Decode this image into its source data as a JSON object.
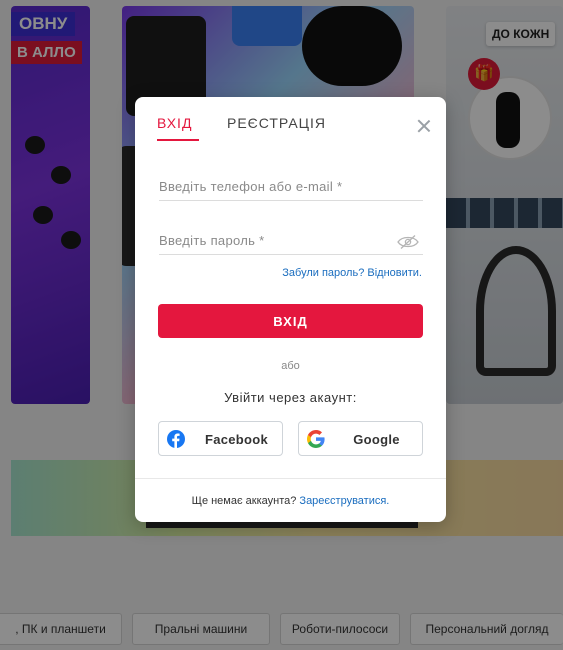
{
  "background": {
    "promo_left_line1": "ОВНУ",
    "promo_left_line2": "В АЛЛО",
    "promo_right": "ДО КОЖН",
    "categories": [
      {
        "label": ", ПК и планшети"
      },
      {
        "label": "Пральні машини"
      },
      {
        "label": "Роботи-пилососи"
      },
      {
        "label": "Персональний догляд"
      }
    ]
  },
  "modal": {
    "tabs": [
      {
        "label": "ВХІД",
        "active": true
      },
      {
        "label": "РЕЄСТРАЦІЯ",
        "active": false
      }
    ],
    "login_input": {
      "placeholder": "Введіть телефон або e-mail *",
      "value": ""
    },
    "password_input": {
      "placeholder": "Введіть пароль *",
      "value": ""
    },
    "forgot_link": "Забули пароль? Відновити.",
    "submit_label": "ВХІД",
    "or_text": "або",
    "via_account_text": "Увійти через акаунт:",
    "social": {
      "facebook_label": "Facebook",
      "google_label": "Google"
    },
    "footer": {
      "question": "Ще немає аккаунта?",
      "register_link": "Зареєструватися."
    }
  },
  "colors": {
    "accent": "#e4173e",
    "link": "#1a6dbf",
    "facebook": "#1877f2"
  },
  "icons": [
    "close-icon",
    "eye-off-icon",
    "facebook-icon",
    "google-icon",
    "gift-icon"
  ]
}
